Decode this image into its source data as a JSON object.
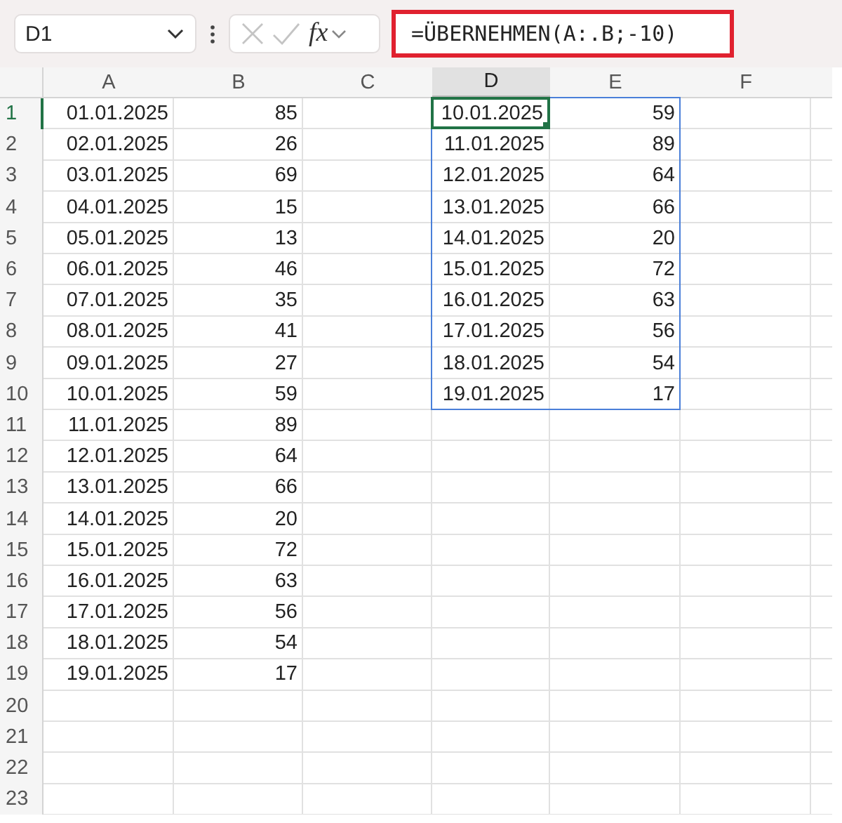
{
  "formula_bar": {
    "name_box": "D1",
    "function_button": "fx",
    "formula": "=ÜBERNEHMEN(A:.B;-10)",
    "highlighted": true
  },
  "columns": [
    {
      "label": "A",
      "selected": false
    },
    {
      "label": "B",
      "selected": false
    },
    {
      "label": "C",
      "selected": false
    },
    {
      "label": "D",
      "selected": true
    },
    {
      "label": "E",
      "selected": false
    },
    {
      "label": "F",
      "selected": false
    }
  ],
  "rows": [
    {
      "label": "1",
      "selected": true,
      "cells": {
        "A": "01.01.2025",
        "B": "85"
      },
      "spill": {
        "D": "10.01.2025",
        "E": "59"
      }
    },
    {
      "label": "2",
      "selected": false,
      "cells": {
        "A": "02.01.2025",
        "B": "26"
      },
      "spill": {
        "D": "11.01.2025",
        "E": "89"
      }
    },
    {
      "label": "3",
      "selected": false,
      "cells": {
        "A": "03.01.2025",
        "B": "69"
      },
      "spill": {
        "D": "12.01.2025",
        "E": "64"
      }
    },
    {
      "label": "4",
      "selected": false,
      "cells": {
        "A": "04.01.2025",
        "B": "15"
      },
      "spill": {
        "D": "13.01.2025",
        "E": "66"
      }
    },
    {
      "label": "5",
      "selected": false,
      "cells": {
        "A": "05.01.2025",
        "B": "13"
      },
      "spill": {
        "D": "14.01.2025",
        "E": "20"
      }
    },
    {
      "label": "6",
      "selected": false,
      "cells": {
        "A": "06.01.2025",
        "B": "46"
      },
      "spill": {
        "D": "15.01.2025",
        "E": "72"
      }
    },
    {
      "label": "7",
      "selected": false,
      "cells": {
        "A": "07.01.2025",
        "B": "35"
      },
      "spill": {
        "D": "16.01.2025",
        "E": "63"
      }
    },
    {
      "label": "8",
      "selected": false,
      "cells": {
        "A": "08.01.2025",
        "B": "41"
      },
      "spill": {
        "D": "17.01.2025",
        "E": "56"
      }
    },
    {
      "label": "9",
      "selected": false,
      "cells": {
        "A": "09.01.2025",
        "B": "27"
      },
      "spill": {
        "D": "18.01.2025",
        "E": "54"
      }
    },
    {
      "label": "10",
      "selected": false,
      "cells": {
        "A": "10.01.2025",
        "B": "59"
      },
      "spill": {
        "D": "19.01.2025",
        "E": "17"
      }
    },
    {
      "label": "11",
      "selected": false,
      "cells": {
        "A": "11.01.2025",
        "B": "89"
      }
    },
    {
      "label": "12",
      "selected": false,
      "cells": {
        "A": "12.01.2025",
        "B": "64"
      }
    },
    {
      "label": "13",
      "selected": false,
      "cells": {
        "A": "13.01.2025",
        "B": "66"
      }
    },
    {
      "label": "14",
      "selected": false,
      "cells": {
        "A": "14.01.2025",
        "B": "20"
      }
    },
    {
      "label": "15",
      "selected": false,
      "cells": {
        "A": "15.01.2025",
        "B": "72"
      }
    },
    {
      "label": "16",
      "selected": false,
      "cells": {
        "A": "16.01.2025",
        "B": "63"
      }
    },
    {
      "label": "17",
      "selected": false,
      "cells": {
        "A": "17.01.2025",
        "B": "56"
      }
    },
    {
      "label": "18",
      "selected": false,
      "cells": {
        "A": "18.01.2025",
        "B": "54"
      }
    },
    {
      "label": "19",
      "selected": false,
      "cells": {
        "A": "19.01.2025",
        "B": "17"
      }
    },
    {
      "label": "20",
      "selected": false,
      "cells": {}
    },
    {
      "label": "21",
      "selected": false,
      "cells": {}
    },
    {
      "label": "22",
      "selected": false,
      "cells": {}
    },
    {
      "label": "23",
      "selected": false,
      "cells": {}
    }
  ]
}
